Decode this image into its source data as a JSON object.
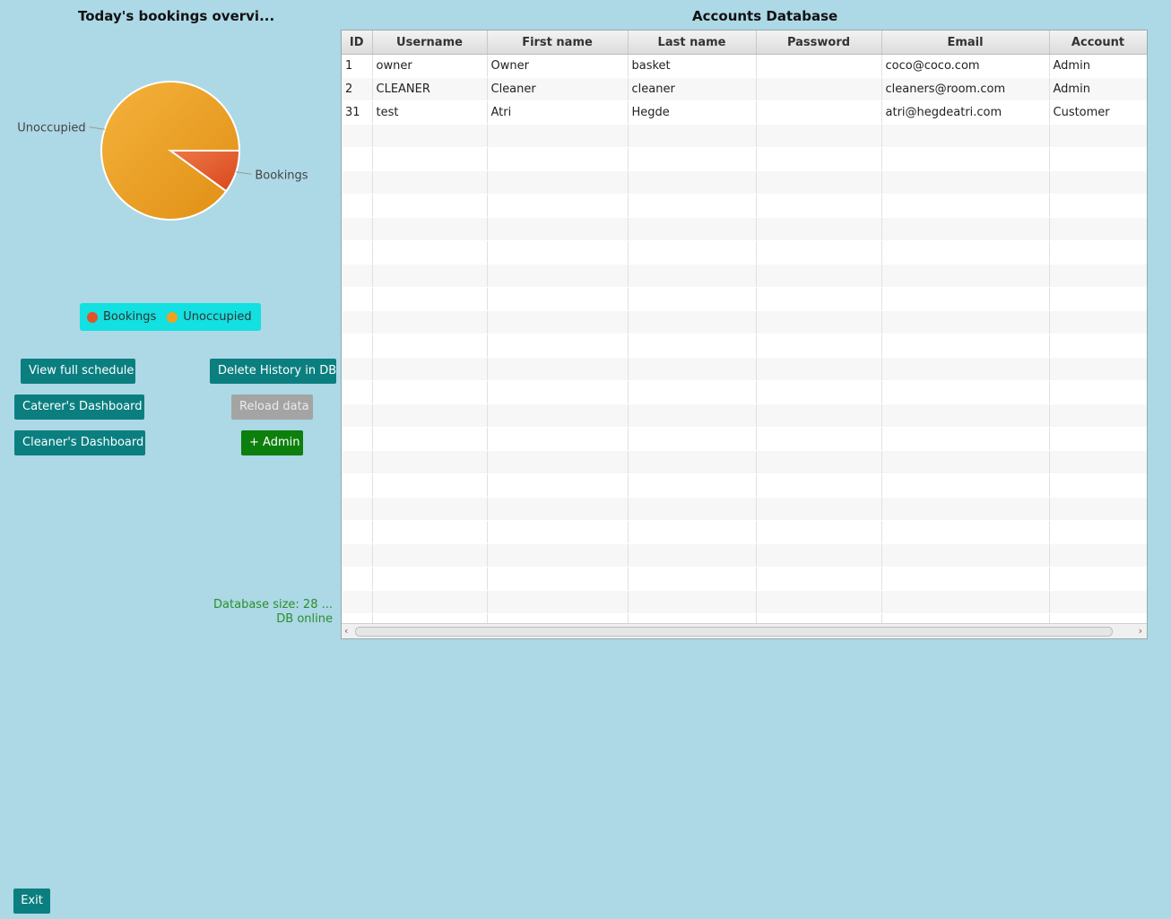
{
  "overview": {
    "title": "Today's bookings overvi...",
    "legend": [
      {
        "label": "Bookings",
        "color": "#e0542a"
      },
      {
        "label": "Unoccupied",
        "color": "#f0a020"
      }
    ]
  },
  "chart_data": {
    "type": "pie",
    "labels": [
      "Bookings",
      "Unoccupied"
    ],
    "values": [
      1,
      9
    ],
    "colors": [
      "#e05a2c",
      "#eea12a"
    ]
  },
  "buttons": {
    "view_schedule": "View full schedule",
    "delete_history": "Delete History in DB",
    "caterer_dashboard": "Caterer's Dashboard",
    "reload_data": "Reload data",
    "cleaner_dashboard": "Cleaner's Dashboard",
    "add_admin": "+ Admin",
    "exit": "Exit"
  },
  "status": {
    "db_size": "Database size: 28 ...",
    "db_online": "DB online"
  },
  "accounts": {
    "title": "Accounts Database",
    "columns": [
      "ID",
      "Username",
      "First name",
      "Last name",
      "Password",
      "Email",
      "Account"
    ],
    "rows": [
      [
        "1",
        "owner",
        "Owner",
        "basket",
        "",
        "coco@coco.com",
        "Admin"
      ],
      [
        "2",
        "CLEANER",
        "Cleaner",
        "cleaner",
        "",
        "cleaners@room.com",
        "Admin"
      ],
      [
        "31",
        "test",
        "Atri",
        "Hegde",
        "",
        "atri@hegdeatri.com",
        "Customer"
      ]
    ]
  }
}
